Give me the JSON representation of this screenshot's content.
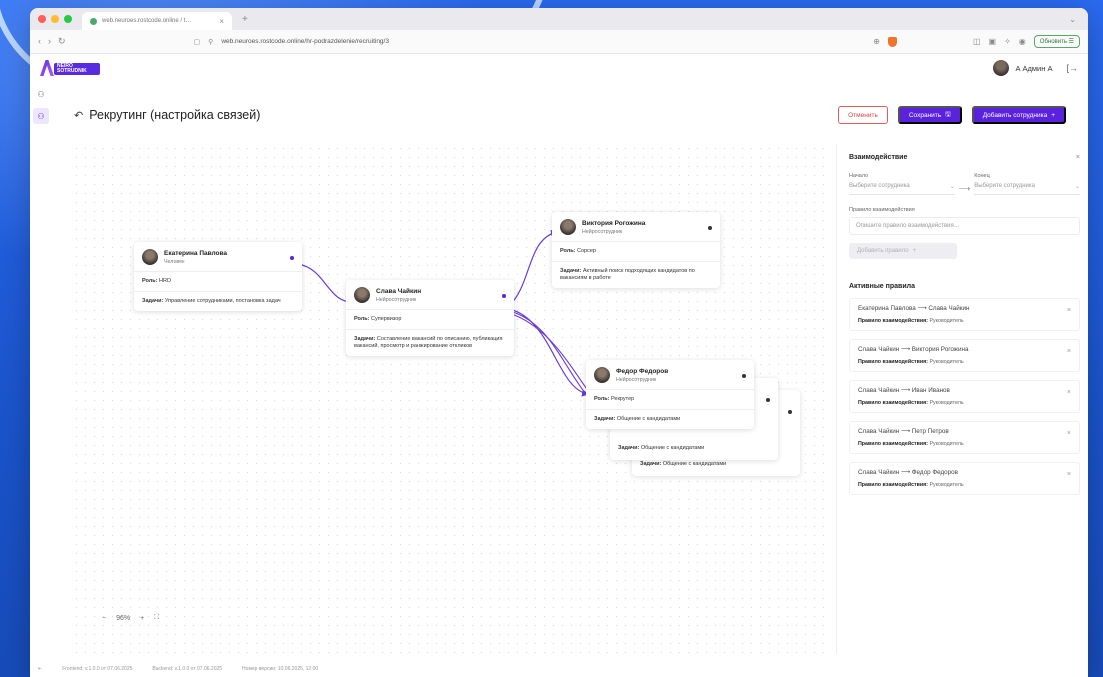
{
  "browser": {
    "tab_title": "web.neuroes.rostcode.online / t…",
    "url": "web.neuroes.rostcode.online/hr-podrazdelenie/recruiting/3",
    "update_label": "Обновить"
  },
  "header": {
    "logo_text": "NEIRO SOTRUDNIK",
    "user_name": "А Админ А"
  },
  "page": {
    "title": "Рекрутинг (настройка связей)",
    "cancel_label": "Отменить",
    "save_label": "Сохранить",
    "add_employee_label": "Добавить сотрудника"
  },
  "cards": [
    {
      "name": "Екатерина Павлова",
      "position": "Человек",
      "role_label": "Роль:",
      "role": "HRD",
      "task_label": "Задачи:",
      "task": "Управление сотрудниками, постановка задач"
    },
    {
      "name": "Слава Чайкин",
      "position": "Нейросотрудник",
      "role_label": "Роль:",
      "role": "Супервизор",
      "task_label": "Задачи:",
      "task": "Составление вакансий по описанию, публикация вакансий, просмотр и ранжирование откликов"
    },
    {
      "name": "Виктория Рогожина",
      "position": "Нейросотрудник",
      "role_label": "Роль:",
      "role": "Сорсер",
      "task_label": "Задачи:",
      "task": "Активный поиск подходящих кандидатов по вакансиям в работе"
    },
    {
      "name": "Федор Федоров",
      "position": "Нейросотрудник",
      "role_label": "Роль:",
      "role": "Рекрутер",
      "task_label": "Задачи:",
      "task": "Общение с кандидатами"
    },
    {
      "task_label": "Задачи:",
      "task": "Общение с кандидатами"
    },
    {
      "task_label": "Задачи:",
      "task": "Общение с кандидатами"
    }
  ],
  "zoom": {
    "minus": "−",
    "value": "96%",
    "plus": "+"
  },
  "panel": {
    "title": "Взаимодействие",
    "start_label": "Начало",
    "end_label": "Конец",
    "start_placeholder": "Выберите сотрудника",
    "end_placeholder": "Выберите сотрудника",
    "rule_label": "Правило взаимодействия",
    "rule_placeholder": "Опишите правило взаимодействия…",
    "add_rule_label": "Добавить правило",
    "active_title": "Активные правила",
    "rules": [
      {
        "from": "Екатерина Павлова",
        "to": "Слава Чайкин",
        "desc_label": "Правило взаимодействия:",
        "desc": "Руководитель"
      },
      {
        "from": "Слава Чайкин",
        "to": "Виктория Рогожина",
        "desc_label": "Правило взаимодействия:",
        "desc": "Руководитель"
      },
      {
        "from": "Слава Чайкин",
        "to": "Иван Иванов",
        "desc_label": "Правило взаимодействия:",
        "desc": "Руководитель"
      },
      {
        "from": "Слава Чайкин",
        "to": "Петр Петров",
        "desc_label": "Правило взаимодействия:",
        "desc": "Руководитель"
      },
      {
        "from": "Слава Чайкин",
        "to": "Федор Федоров",
        "desc_label": "Правило взаимодействия:",
        "desc": "Руководитель"
      }
    ]
  },
  "footer": {
    "frontend": "Frontend: v.1.0.0 от 07.06.2025",
    "backend": "Backend: v.1.0.0 от 07.06.2025",
    "build": "Номер версии: 10.06.2025, 12:00"
  },
  "colors": {
    "accent": "#5a22dc",
    "cancel": "#d64545",
    "edge": "#6a3bd8"
  }
}
